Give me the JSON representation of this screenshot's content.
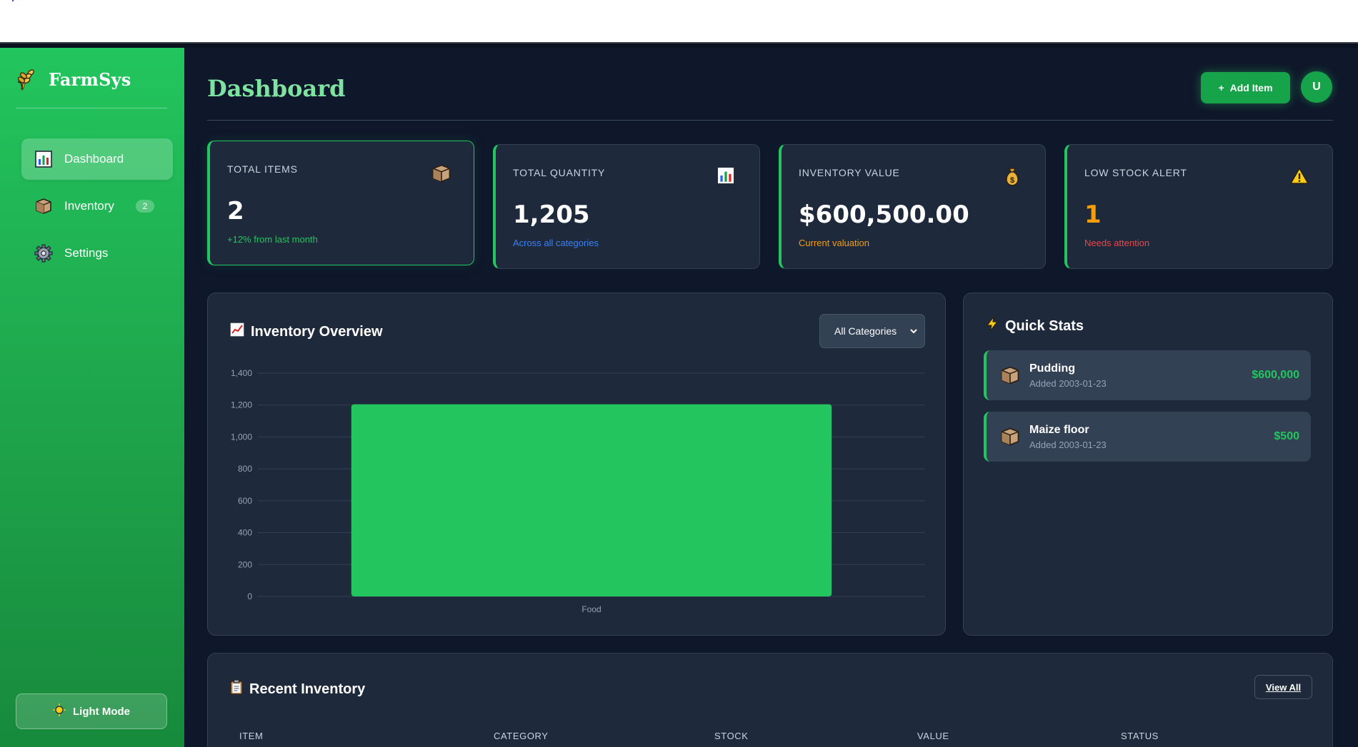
{
  "app": {
    "name": "FarmSys"
  },
  "sidebar": {
    "items": [
      {
        "label": "Dashboard",
        "icon": "bar-chart-icon",
        "active": true
      },
      {
        "label": "Inventory",
        "icon": "package-icon",
        "badge": "2"
      },
      {
        "label": "Settings",
        "icon": "gear-icon"
      }
    ],
    "theme_toggle": {
      "label": "Light Mode",
      "icon": "sun-icon"
    }
  },
  "header": {
    "title": "Dashboard",
    "add_button": "Add Item",
    "add_button_prefix": "+",
    "avatar_initial": "U"
  },
  "stats": [
    {
      "label": "TOTAL ITEMS",
      "value": "2",
      "sub": "+12% from last month",
      "sub_color": "#22c55e",
      "icon": "package-icon"
    },
    {
      "label": "TOTAL QUANTITY",
      "value": "1,205",
      "sub": "Across all categories",
      "sub_color": "#3b82f6",
      "icon": "bar-chart-icon"
    },
    {
      "label": "INVENTORY VALUE",
      "value": "$600,500.00",
      "sub": "Current valuation",
      "sub_color": "#f59e0b",
      "icon": "money-bag-icon"
    },
    {
      "label": "LOW STOCK ALERT",
      "value": "1",
      "sub": "Needs attention",
      "sub_color": "#ef4444",
      "value_color": "#f59e0b",
      "icon": "warning-icon"
    }
  ],
  "overview": {
    "title": "Inventory Overview",
    "filter": {
      "selected": "All Categories"
    }
  },
  "chart_data": {
    "type": "bar",
    "categories": [
      "Food"
    ],
    "values": [
      1205
    ],
    "ylim": [
      0,
      1400
    ],
    "yticks": [
      "0",
      "200",
      "400",
      "600",
      "800",
      "1,000",
      "1,200",
      "1,400"
    ],
    "bar_color": "#22c55e",
    "grid": true
  },
  "quick_stats": {
    "title": "Quick Stats",
    "items": [
      {
        "name": "Pudding",
        "date": "Added 2003-01-23",
        "value": "$600,000"
      },
      {
        "name": "Maize floor",
        "date": "Added 2003-01-23",
        "value": "$500"
      }
    ]
  },
  "recent": {
    "title": "Recent Inventory",
    "view_all": "View All",
    "columns": [
      "ITEM",
      "CATEGORY",
      "STOCK",
      "VALUE",
      "STATUS"
    ]
  },
  "colors": {
    "accent": "#22c55e",
    "background": "#0f172a",
    "card": "#1e293b"
  }
}
